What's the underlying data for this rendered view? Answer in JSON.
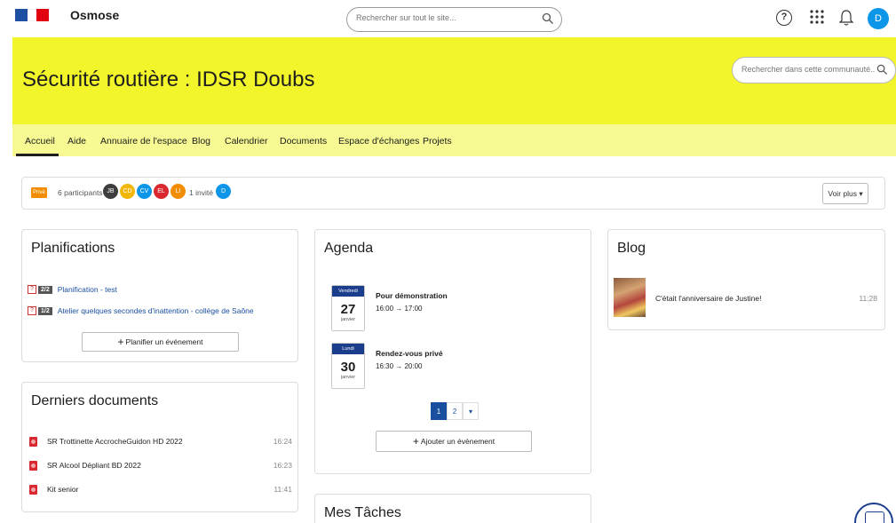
{
  "header": {
    "brand": "Osmose",
    "search_placeholder": "Rechercher sur tout le site...",
    "avatar_initial": "D",
    "help_symbol": "?"
  },
  "community": {
    "title": "Sécurité routière : IDSR Doubs",
    "search_placeholder": "Rechercher dans cette communauté..."
  },
  "nav": {
    "tabs": [
      {
        "label": "Accueil"
      },
      {
        "label": "Aide"
      },
      {
        "label": "Annuaire de l'espace"
      },
      {
        "label": "Blog"
      },
      {
        "label": "Calendrier"
      },
      {
        "label": "Documents"
      },
      {
        "label": "Espace d'échanges"
      },
      {
        "label": "Projets"
      }
    ]
  },
  "participants": {
    "badge": "Privé",
    "count_label": "6 participants",
    "avatars": [
      {
        "initials": "JB",
        "color": "#3d3d3d"
      },
      {
        "initials": "CD",
        "color": "#f2b705"
      },
      {
        "initials": "CV",
        "color": "#0d95e8"
      },
      {
        "initials": "EL",
        "color": "#d9282f"
      },
      {
        "initials": "LI",
        "color": "#f28c00"
      }
    ],
    "invite_label": "1 invité",
    "invite_avatar": {
      "initials": "D",
      "color": "#0d95e8"
    },
    "more_label": "Voir plus ▾"
  },
  "planifications": {
    "title": "Planifications",
    "items": [
      {
        "ratio": "2/2",
        "label": "Planification - test"
      },
      {
        "ratio": "1/2",
        "label": "Atelier quelques secondes d'inattention - collège de Saône"
      }
    ],
    "button": "Planifier un événement"
  },
  "documents": {
    "title": "Derniers documents",
    "items": [
      {
        "name": "SR Trottinette AccrocheGuidon HD 2022",
        "time": "16:24"
      },
      {
        "name": "SR Alcool Dépliant BD 2022",
        "time": "16:23"
      },
      {
        "name": "Kit senior",
        "time": "11:41"
      }
    ]
  },
  "agenda": {
    "title": "Agenda",
    "events": [
      {
        "day": "Vendredi",
        "num": "27",
        "month": "janvier",
        "title": "Pour démonstration",
        "time": "16:00 → 17:00"
      },
      {
        "day": "Lundi",
        "num": "30",
        "month": "janvier",
        "title": "Rendez-vous privé",
        "time": "16:30 → 20:00"
      }
    ],
    "pages": [
      "1",
      "2",
      "▾"
    ],
    "button": "Ajouter un évènement"
  },
  "blog": {
    "title": "Blog",
    "post_title": "C'était l'anniversaire de Justine!",
    "post_time": "11:28"
  },
  "tasks": {
    "title": "Mes Tâches"
  }
}
